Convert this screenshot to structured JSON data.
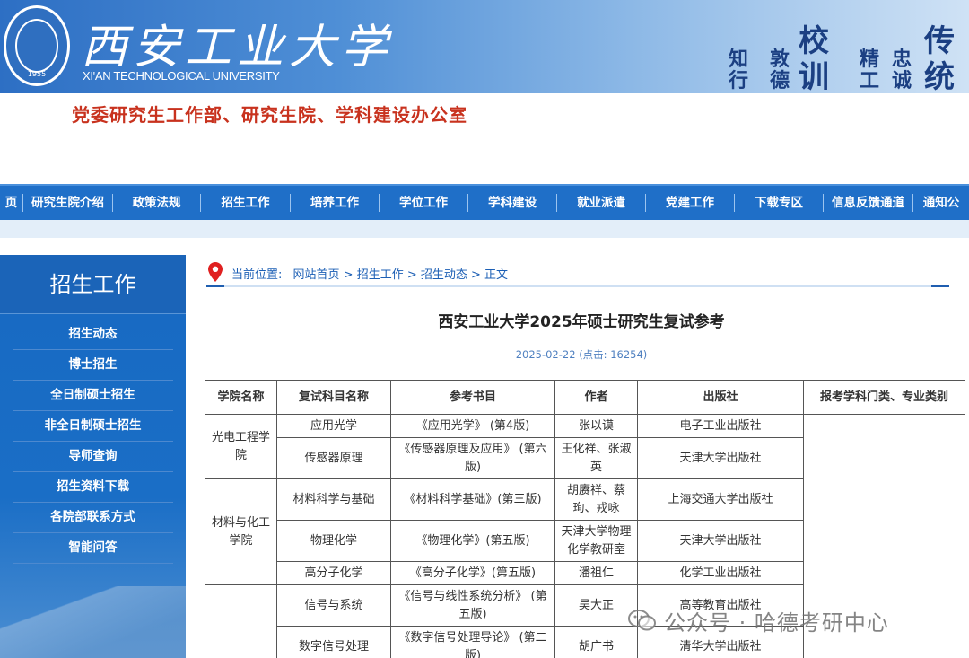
{
  "header": {
    "university_cn": "西安工业大学",
    "university_en": "XI'AN TECHNOLOGICAL UNIVERSITY",
    "emblem_year": "1955",
    "motto_label_1": "校",
    "motto_label_2": "训",
    "motto_label_3": "传",
    "motto_label_4": "统",
    "motto_col_1": "知行",
    "motto_col_2": "敦德",
    "motto_col_3": "精工",
    "motto_col_4": "忠诚",
    "department": "党委研究生工作部、研究生院、学科建设办公室"
  },
  "nav": {
    "items": [
      "页",
      "研究生院介绍",
      "政策法规",
      "招生工作",
      "培养工作",
      "学位工作",
      "学科建设",
      "就业派遣",
      "党建工作",
      "下载专区",
      "信息反馈通道",
      "通知公"
    ]
  },
  "sidebar": {
    "title": "招生工作",
    "items": [
      "招生动态",
      "博士招生",
      "全日制硕士招生",
      "非全日制硕士招生",
      "导师查询",
      "招生资料下载",
      "各院部联系方式",
      "智能问答"
    ]
  },
  "breadcrumb": {
    "label": "当前位置:",
    "path": "网站首页 > 招生工作 > 招生动态 > 正文"
  },
  "article": {
    "title": "西安工业大学2025年硕士研究生复试参考",
    "meta": "2025-02-22 (点击: 16254)"
  },
  "table": {
    "headers": [
      "学院名称",
      "复试科目名称",
      "参考书目",
      "作者",
      "出版社",
      "报考学科门类、专业类别"
    ],
    "rows": [
      {
        "college": "光电工程学院",
        "subject": "应用光学",
        "book": "《应用光学》 (第4版)",
        "author": "张以谟",
        "publisher": "电子工业出版社"
      },
      {
        "subject": "传感器原理",
        "book": "《传感器原理及应用》 (第六版)",
        "author": "王化祥、张淑英",
        "publisher": "天津大学出版社"
      },
      {
        "college": "材料与化工学院",
        "subject": "材料科学与基础",
        "book": "《材料科学基础》(第三版)",
        "author": "胡赓祥、蔡珣、戎咏",
        "publisher": "上海交通大学出版社"
      },
      {
        "subject": "物理化学",
        "book": "《物理化学》(第五版)",
        "author": "天津大学物理化学教研室",
        "publisher": "天津大学出版社"
      },
      {
        "subject": "高分子化学",
        "book": "《高分子化学》(第五版)",
        "author": "潘祖仁",
        "publisher": "化学工业出版社"
      },
      {
        "college": "",
        "subject": "信号与系统",
        "book": "《信号与线性系统分析》 (第五版)",
        "author": "吴大正",
        "publisher": "高等教育出版社"
      },
      {
        "subject": "数字信号处理",
        "book": "《数字信号处理导论》 (第二版)",
        "author": "胡广书",
        "publisher": "清华大学出版社"
      }
    ],
    "category": ""
  },
  "watermark": {
    "text": "公众号 · 哈德考研中心"
  },
  "colors": {
    "nav_blue": "#1f6fc8",
    "sidebar_blue": "#1769c2",
    "dept_red": "#c8321e",
    "link_blue": "#1c5fb5"
  }
}
